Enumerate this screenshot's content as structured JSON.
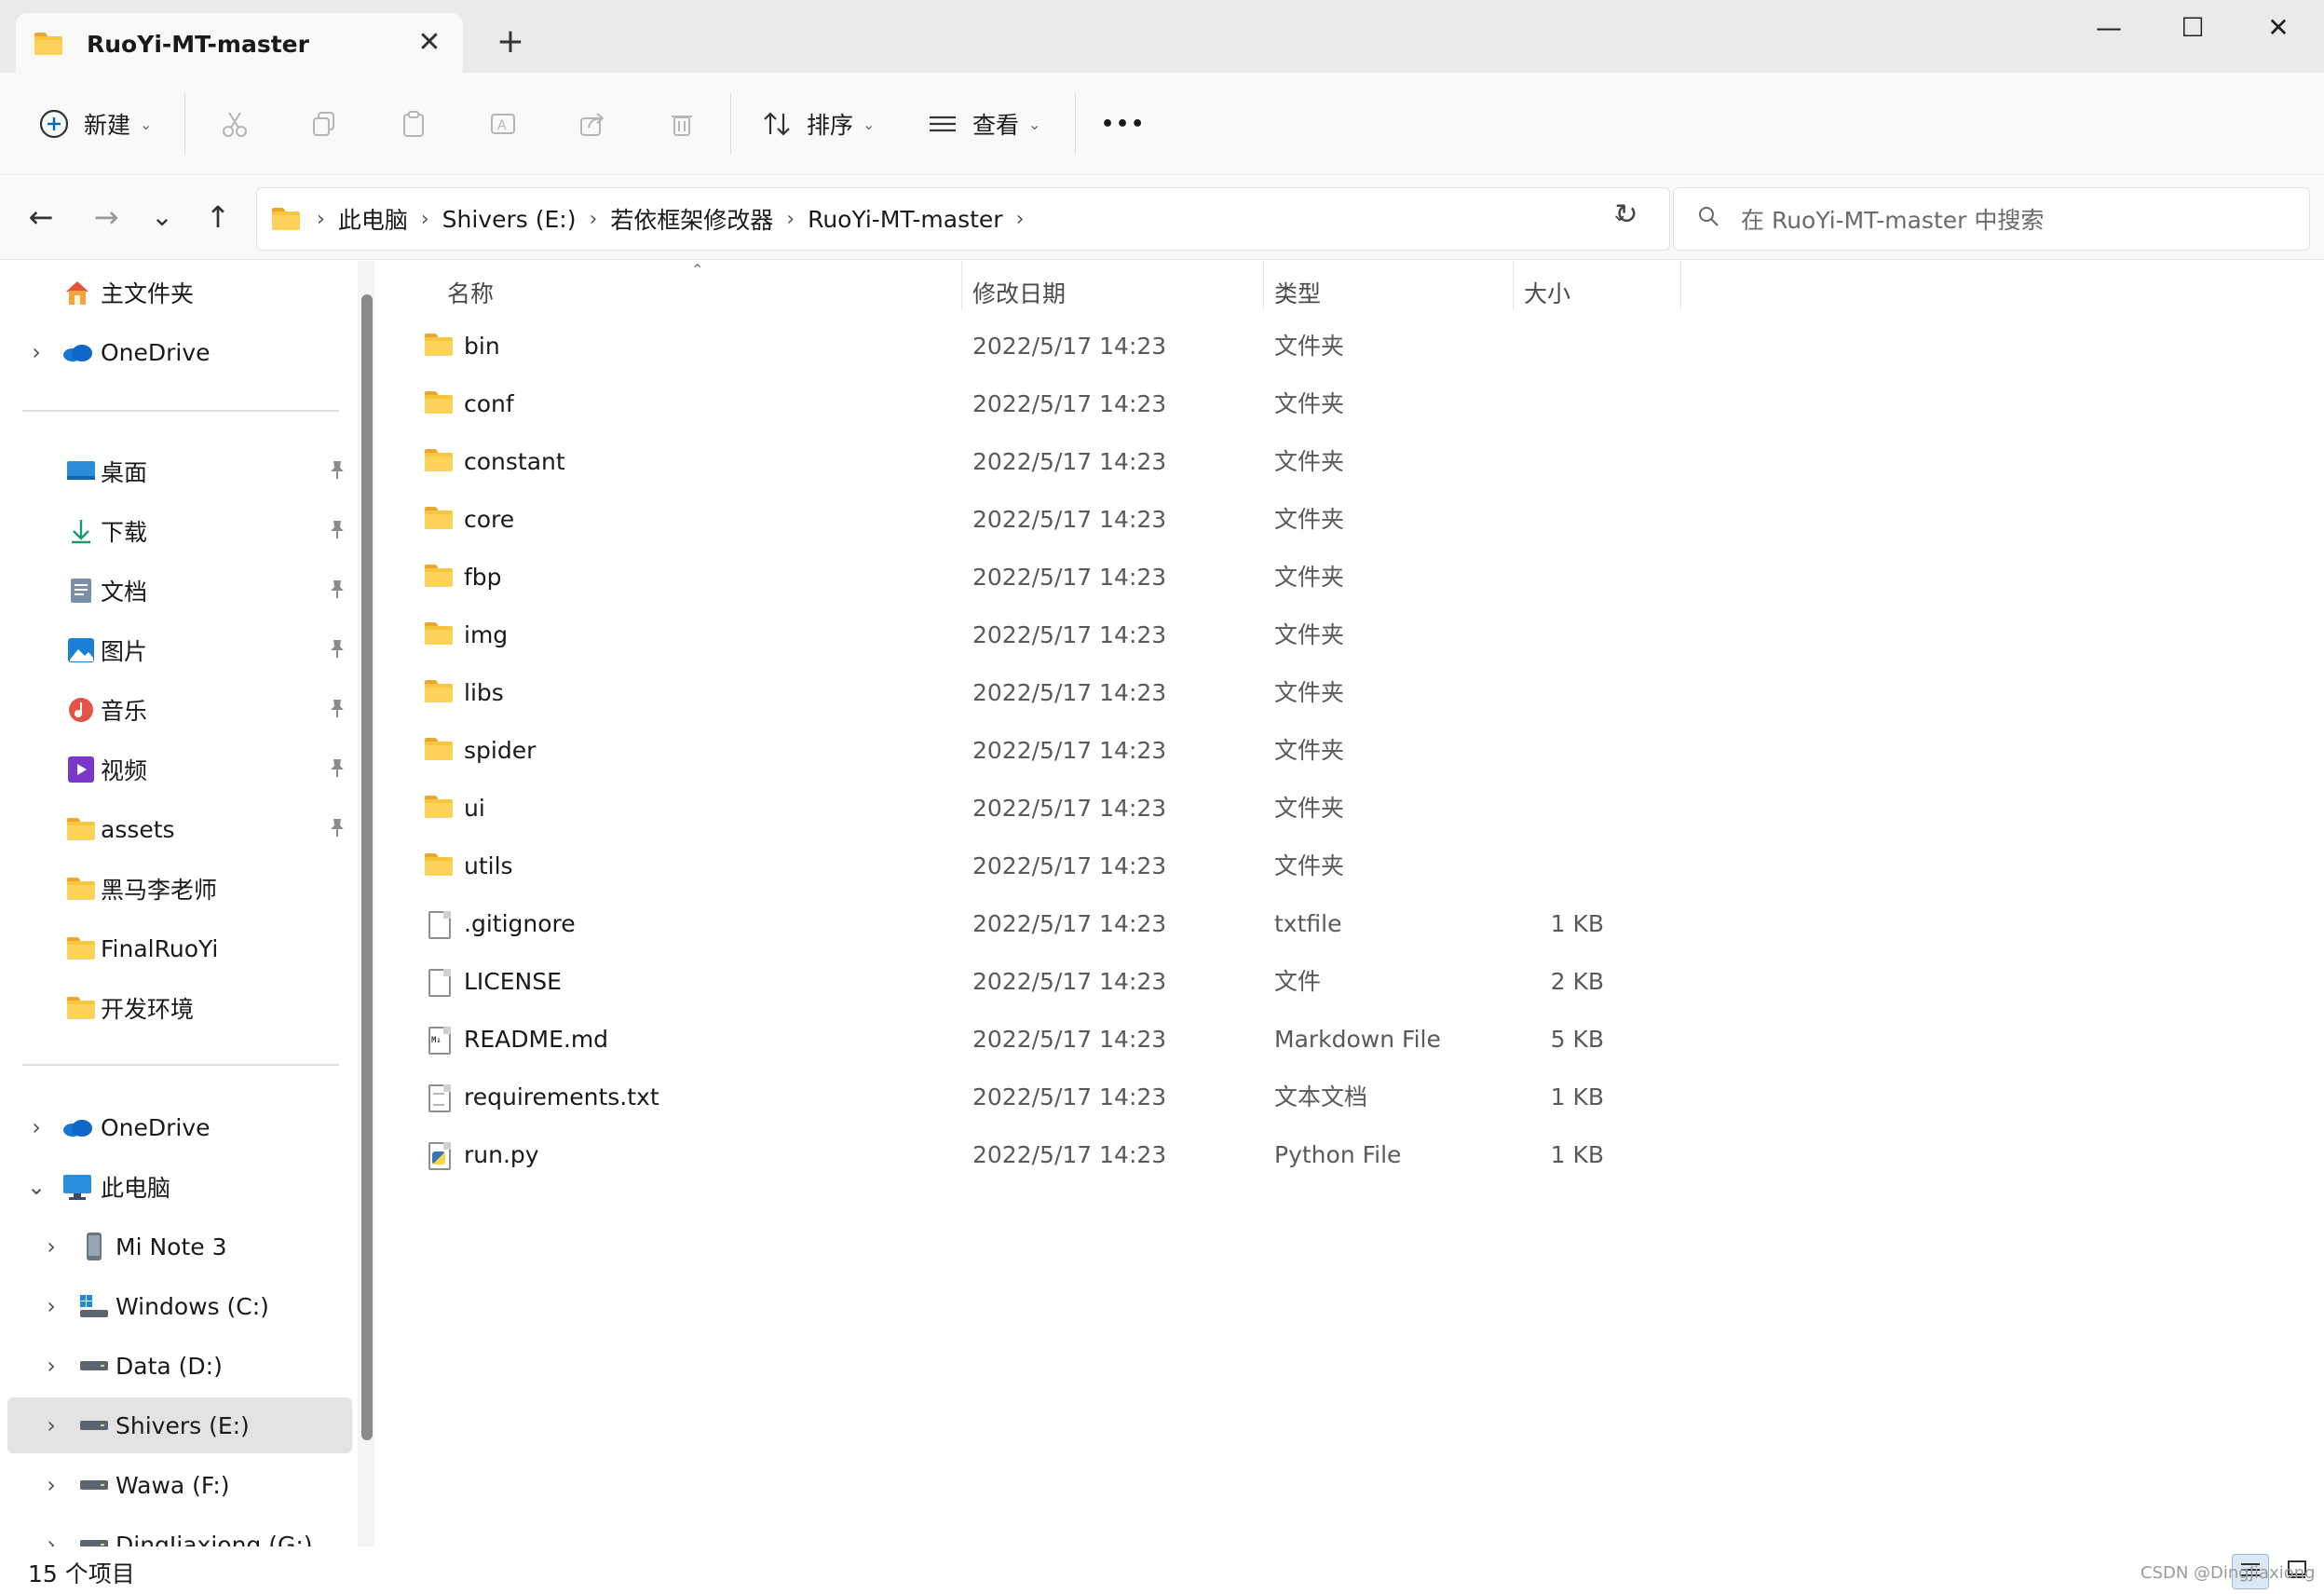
{
  "window": {
    "tab_title": "RuoYi-MT-master",
    "tab_close": "✕",
    "tab_add": "+",
    "minimize": "—",
    "maximize": "☐",
    "close": "✕"
  },
  "toolbar": {
    "new_label": "新建",
    "sort_label": "排序",
    "view_label": "查看",
    "more_label": "•••"
  },
  "nav": {
    "back": "←",
    "forward": "→",
    "recent": "⌄",
    "up": "↑",
    "refresh": "↻"
  },
  "address": {
    "crumbs": [
      "此电脑",
      "Shivers (E:)",
      "若依框架修改器",
      "RuoYi-MT-master"
    ],
    "separator": "›"
  },
  "search": {
    "placeholder": "在 RuoYi-MT-master 中搜索"
  },
  "sidebar": {
    "quick": [
      {
        "label": "主文件夹",
        "icon": "home-icon"
      },
      {
        "label": "OneDrive",
        "icon": "onedrive-icon",
        "chevron": "›"
      }
    ],
    "pinned": [
      {
        "label": "桌面",
        "icon": "desktop-icon",
        "pinned": true
      },
      {
        "label": "下载",
        "icon": "download-icon",
        "pinned": true
      },
      {
        "label": "文档",
        "icon": "documents-icon",
        "pinned": true
      },
      {
        "label": "图片",
        "icon": "pictures-icon",
        "pinned": true
      },
      {
        "label": "音乐",
        "icon": "music-icon",
        "pinned": true
      },
      {
        "label": "视频",
        "icon": "videos-icon",
        "pinned": true
      },
      {
        "label": "assets",
        "icon": "folder-icon",
        "pinned": true
      },
      {
        "label": "黑马李老师",
        "icon": "folder-icon"
      },
      {
        "label": "FinalRuoYi",
        "icon": "folder-icon"
      },
      {
        "label": "开发环境",
        "icon": "folder-icon"
      }
    ],
    "tree": [
      {
        "label": "OneDrive",
        "icon": "onedrive-icon",
        "chevron": "›"
      },
      {
        "label": "此电脑",
        "icon": "this-pc-icon",
        "chevron": "⌄"
      },
      {
        "label": "Mi Note 3",
        "icon": "phone-icon",
        "chevron": "›"
      },
      {
        "label": "Windows (C:)",
        "icon": "windows-drive-icon",
        "chevron": "›"
      },
      {
        "label": "Data (D:)",
        "icon": "drive-icon",
        "chevron": "›"
      },
      {
        "label": "Shivers (E:)",
        "icon": "drive-icon",
        "chevron": "›",
        "selected": true
      },
      {
        "label": "Wawa (F:)",
        "icon": "drive-icon",
        "chevron": "›"
      },
      {
        "label": "DingJiaxiong (G:)",
        "icon": "drive-icon",
        "chevron": "›"
      }
    ],
    "pin_glyph": "📌"
  },
  "columns": {
    "name": "名称",
    "date": "修改日期",
    "type": "类型",
    "size": "大小"
  },
  "files": [
    {
      "name": "bin",
      "date": "2022/5/17 14:23",
      "type": "文件夹",
      "size": "",
      "icon": "folder-icon"
    },
    {
      "name": "conf",
      "date": "2022/5/17 14:23",
      "type": "文件夹",
      "size": "",
      "icon": "folder-icon"
    },
    {
      "name": "constant",
      "date": "2022/5/17 14:23",
      "type": "文件夹",
      "size": "",
      "icon": "folder-icon"
    },
    {
      "name": "core",
      "date": "2022/5/17 14:23",
      "type": "文件夹",
      "size": "",
      "icon": "folder-icon"
    },
    {
      "name": "fbp",
      "date": "2022/5/17 14:23",
      "type": "文件夹",
      "size": "",
      "icon": "folder-icon"
    },
    {
      "name": "img",
      "date": "2022/5/17 14:23",
      "type": "文件夹",
      "size": "",
      "icon": "folder-icon"
    },
    {
      "name": "libs",
      "date": "2022/5/17 14:23",
      "type": "文件夹",
      "size": "",
      "icon": "folder-icon"
    },
    {
      "name": "spider",
      "date": "2022/5/17 14:23",
      "type": "文件夹",
      "size": "",
      "icon": "folder-icon"
    },
    {
      "name": "ui",
      "date": "2022/5/17 14:23",
      "type": "文件夹",
      "size": "",
      "icon": "folder-icon"
    },
    {
      "name": "utils",
      "date": "2022/5/17 14:23",
      "type": "文件夹",
      "size": "",
      "icon": "folder-icon"
    },
    {
      "name": ".gitignore",
      "date": "2022/5/17 14:23",
      "type": "txtfile",
      "size": "1 KB",
      "icon": "file-icon"
    },
    {
      "name": "LICENSE",
      "date": "2022/5/17 14:23",
      "type": "文件",
      "size": "2 KB",
      "icon": "file-icon"
    },
    {
      "name": "README.md",
      "date": "2022/5/17 14:23",
      "type": "Markdown File",
      "size": "5 KB",
      "icon": "markdown-file-icon"
    },
    {
      "name": "requirements.txt",
      "date": "2022/5/17 14:23",
      "type": "文本文档",
      "size": "1 KB",
      "icon": "text-file-icon"
    },
    {
      "name": "run.py",
      "date": "2022/5/17 14:23",
      "type": "Python File",
      "size": "1 KB",
      "icon": "python-file-icon"
    }
  ],
  "status": {
    "item_count": "15 个项目",
    "watermark": "CSDN @DingJiaxiong"
  },
  "colors": {
    "accent": "#0067c0",
    "folder": "#f8c53f",
    "selected_bg": "#e3e3e3"
  }
}
